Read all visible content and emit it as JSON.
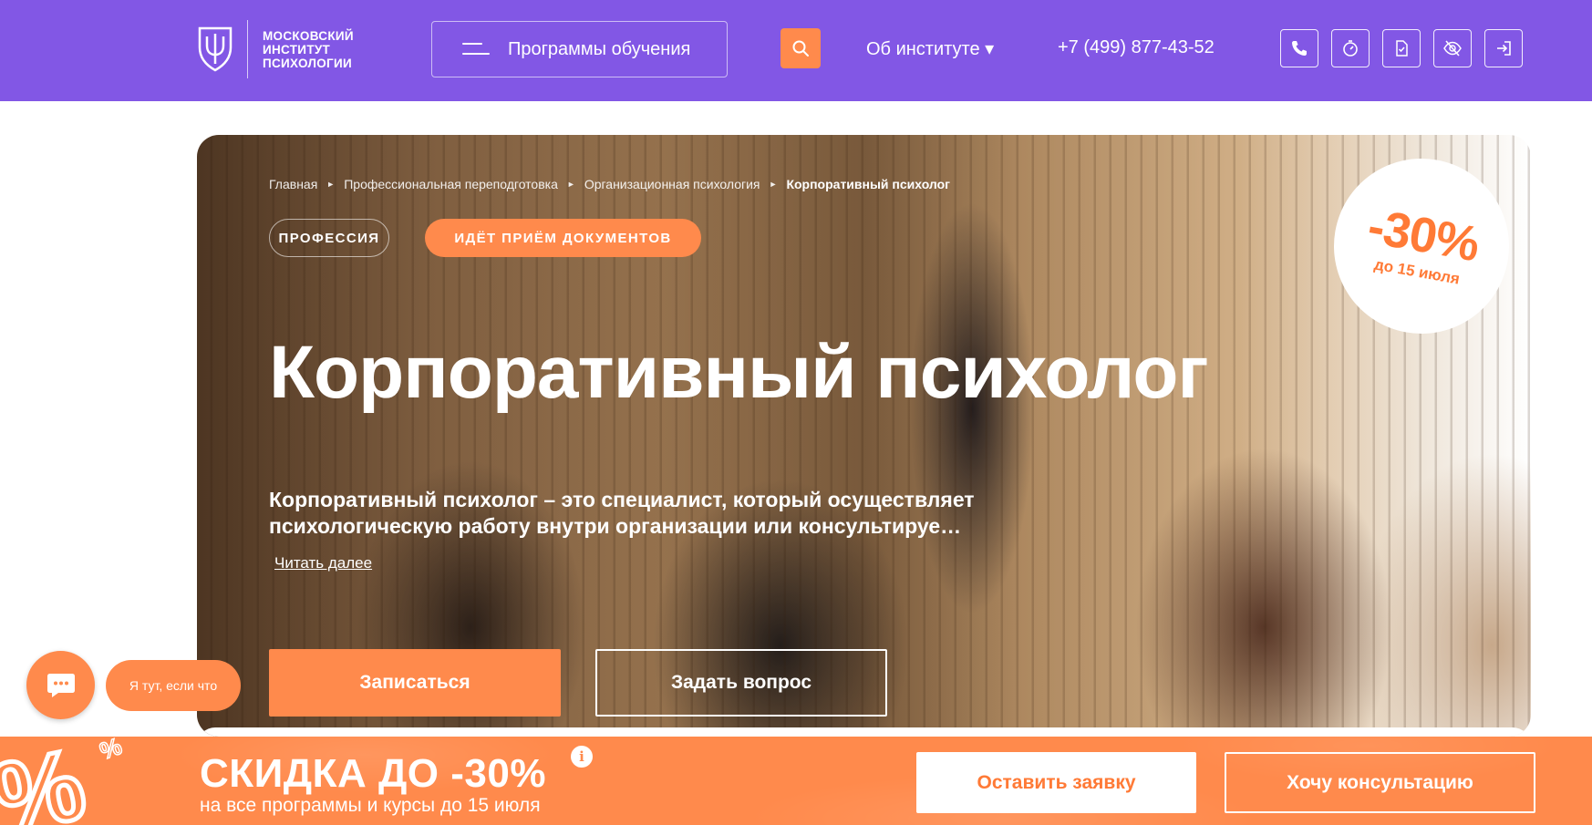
{
  "header": {
    "logo_lines": [
      "МОСКОВСКИЙ",
      "ИНСТИТУТ",
      "ПСИХОЛОГИИ"
    ],
    "programs_label": "Программы обучения",
    "about_label": "Об институте ▾",
    "phone": "+7 (499) 877-43-52",
    "icons": [
      "phone-icon",
      "timer-icon",
      "document-icon",
      "eye-off-icon",
      "login-icon"
    ]
  },
  "hero": {
    "breadcrumb": [
      "Главная",
      "Профессиональная переподготовка",
      "Организационная психология",
      "Корпоративный психолог"
    ],
    "tags": {
      "profession": "ПРОФЕССИЯ",
      "admission": "ИДЁТ ПРИЁМ ДОКУМЕНТОВ"
    },
    "badge": {
      "discount": "-30%",
      "until": "до 15 июля"
    },
    "title": "Корпоративный психолог",
    "description": "Корпоративный психолог – это специалист, который осуществляет психологическую работу внутри организации или консультируе…",
    "read_more": "Читать далее",
    "signup_label": "Записаться",
    "question_label": "Задать вопрос"
  },
  "chat": {
    "bubble_text": "Я тут, если что"
  },
  "promo": {
    "title": "СКИДКА ДО -30%",
    "subtitle": "на все программы и курсы до 15 июля",
    "info": "i",
    "apply_label": "Оставить заявку",
    "consult_label": "Хочу консультацию"
  },
  "colors": {
    "brand_purple": "#8257e5",
    "accent_orange": "#ff8a4c"
  }
}
